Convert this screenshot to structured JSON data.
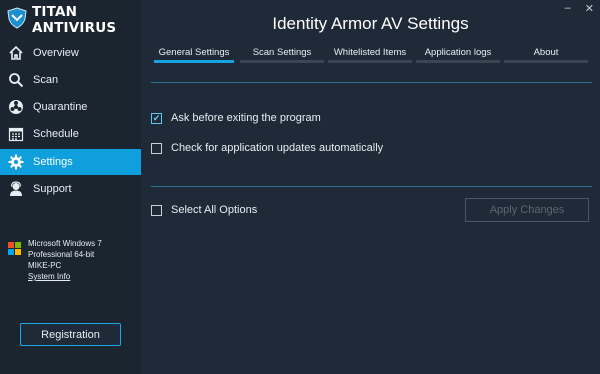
{
  "app": {
    "brand": "TITAN ANTIVIRUS",
    "window_title": "Identity Armor AV Settings",
    "window_controls": [
      "–",
      "✕"
    ]
  },
  "sidebar": {
    "items": [
      {
        "label": "Overview",
        "icon": "home-icon",
        "active": false
      },
      {
        "label": "Scan",
        "icon": "search-icon",
        "active": false
      },
      {
        "label": "Quarantine",
        "icon": "biohazard-icon",
        "active": false
      },
      {
        "label": "Schedule",
        "icon": "calendar-icon",
        "active": false
      },
      {
        "label": "Settings",
        "icon": "gear-icon",
        "active": true
      },
      {
        "label": "Support",
        "icon": "user-support-icon",
        "active": false
      }
    ],
    "system": {
      "line1": "Microsoft Windows 7",
      "line2": "Professional  64-bit",
      "line3": "MIKE-PC",
      "link": "System Info"
    },
    "registration_label": "Registration"
  },
  "tabs": [
    {
      "label": "General Settings",
      "active": true
    },
    {
      "label": "Scan Settings",
      "active": false
    },
    {
      "label": "Whitelisted Items",
      "active": false
    },
    {
      "label": "Application logs",
      "active": false
    },
    {
      "label": "About",
      "active": false
    }
  ],
  "options": [
    {
      "label": "Ask before exiting the program",
      "checked": true
    },
    {
      "label": "Check for application updates automatically",
      "checked": false
    }
  ],
  "select_all_label": "Select All Options",
  "apply_label": "Apply Changes",
  "colors": {
    "accent": "#0f9fdc",
    "background": "#1e2a37",
    "sidebar": "#1a252f"
  }
}
